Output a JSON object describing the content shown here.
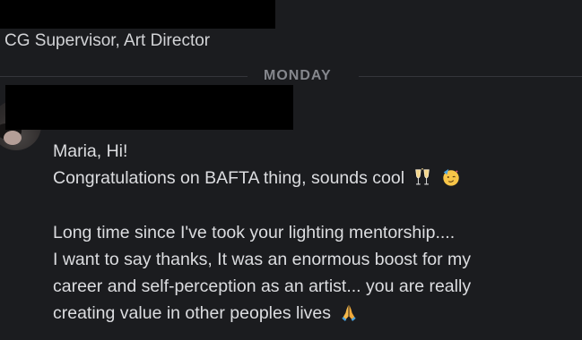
{
  "previous_message": {
    "author_subtitle": "CG Supervisor, Art Director"
  },
  "day_divider": {
    "label": "MONDAY"
  },
  "message": {
    "lines": [
      "Maria, Hi!",
      "Congratulations on BAFTA thing, sounds cool",
      "",
      "Long time since I've took your lighting mentorship....",
      "I want to say thanks, It was an enormous boost for my",
      "career and self-perception as an artist... you are really",
      "creating value in other peoples lives"
    ],
    "emojis": {
      "line_2": [
        "clinking-glasses",
        "partying-face"
      ],
      "line_7": [
        "folded-hands"
      ]
    }
  },
  "colors": {
    "background": "#1b1c1f",
    "text": "#dcdde0",
    "divider_label": "#85878d",
    "divider_line": "#34363b",
    "redaction": "#000000"
  }
}
